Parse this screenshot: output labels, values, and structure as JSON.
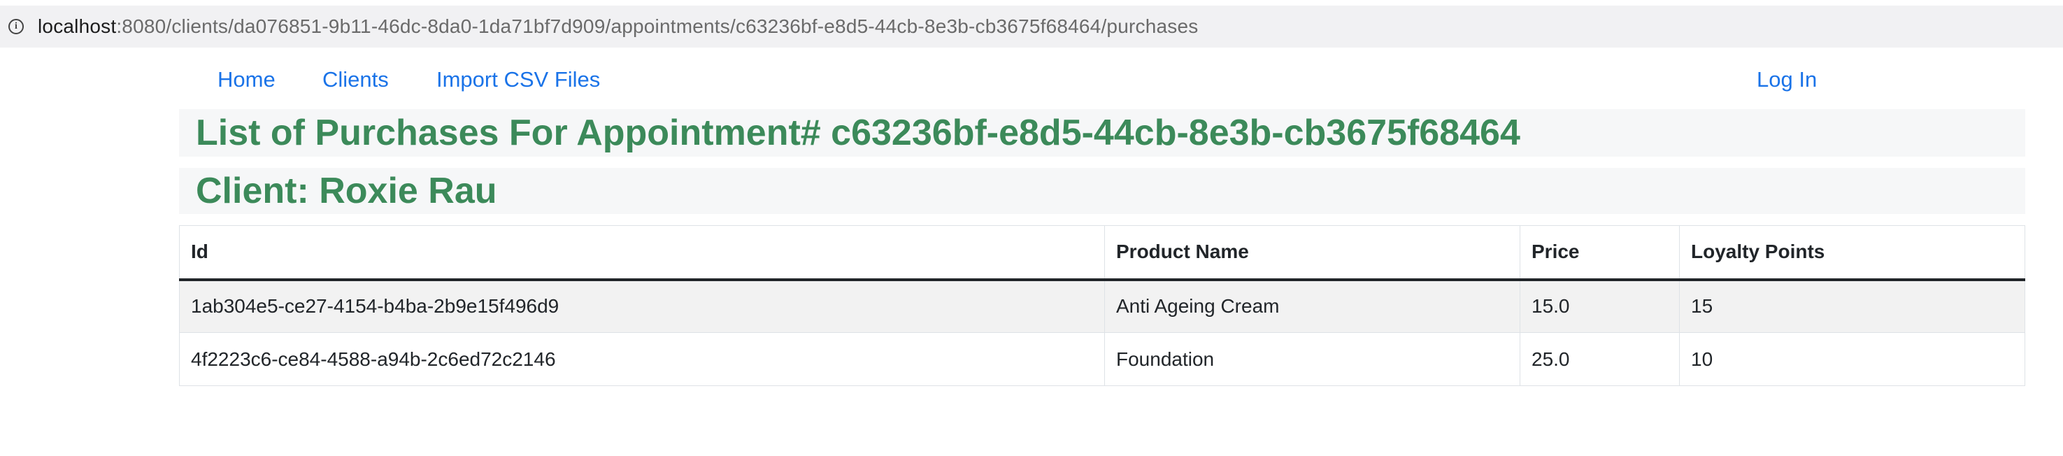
{
  "browser": {
    "url_host": "localhost",
    "url_rest": ":8080/clients/da076851-9b11-46dc-8da0-1da71bf7d909/appointments/c63236bf-e8d5-44cb-8e3b-cb3675f68464/purchases"
  },
  "nav": {
    "home": "Home",
    "clients": "Clients",
    "import_csv": "Import CSV Files",
    "login": "Log In",
    "link_color": "#1a73e8"
  },
  "page": {
    "title": "List of Purchases For Appointment# c63236bf-e8d5-44cb-8e3b-cb3675f68464",
    "client": "Client: Roxie Rau",
    "heading_color": "#3c8a5a"
  },
  "table": {
    "headers": [
      "Id",
      "Product Name",
      "Price",
      "Loyalty Points"
    ],
    "rows": [
      {
        "id": "1ab304e5-ce27-4154-b4ba-2b9e15f496d9",
        "product_name": "Anti Ageing Cream",
        "price": "15.0",
        "loyalty_points": "15"
      },
      {
        "id": "4f2223c6-ce84-4588-a94b-2c6ed72c2146",
        "product_name": "Foundation",
        "price": "25.0",
        "loyalty_points": "10"
      }
    ]
  }
}
